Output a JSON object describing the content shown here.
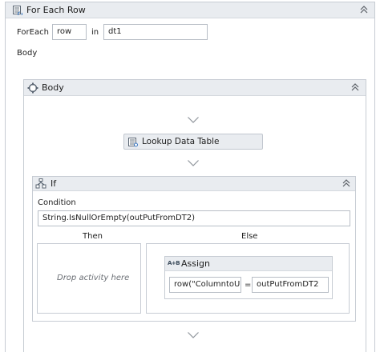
{
  "for_each": {
    "title": "For Each Row",
    "foreach_label": "ForEach",
    "item_value": "row",
    "in_label": "in",
    "collection_value": "dt1",
    "body_label": "Body"
  },
  "sequence": {
    "title": "Body"
  },
  "lookup": {
    "label": "Lookup Data Table"
  },
  "if_activity": {
    "title": "If",
    "condition_label": "Condition",
    "condition_value": "String.IsNullOrEmpty(outPutFromDT2)",
    "then_label": "Then",
    "else_label": "Else",
    "then_placeholder": "Drop activity here"
  },
  "assign": {
    "title": "Assign",
    "to_value": "row(\"ColumntoUp",
    "equals": "=",
    "value": "outPutFromDT2"
  },
  "icons": [
    "foreach-icon",
    "sequence-icon",
    "datatable-icon",
    "if-icon",
    "assign-icon",
    "collapse-icon",
    "insert-arrow-icon"
  ],
  "colors": {
    "header_bg": "#e9ecf0",
    "border": "#c7ccd3",
    "field_border": "#b8bec6"
  }
}
